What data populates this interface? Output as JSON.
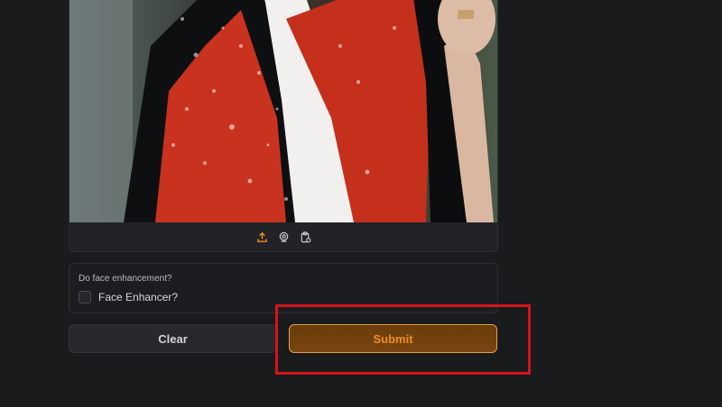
{
  "image_panel": {
    "toolbar_icons": [
      "upload-icon",
      "webcam-icon",
      "clipboard-icon"
    ],
    "accent_color": "#f08a24"
  },
  "face_enhancement": {
    "label": "Do face enhancement?",
    "checkbox_label": "Face Enhancer?",
    "checked": false
  },
  "buttons": {
    "clear_label": "Clear",
    "submit_label": "Submit"
  },
  "colors": {
    "background": "#1a1b1d",
    "submit_text": "#f08a24",
    "highlight_box": "#d4141a"
  }
}
